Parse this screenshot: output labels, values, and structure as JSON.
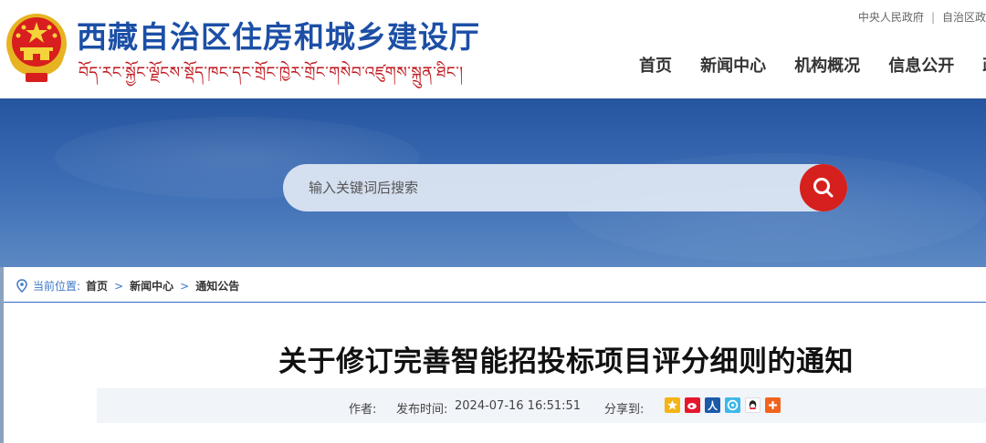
{
  "header": {
    "site_title": "西藏自治区住房和城乡建设厅",
    "site_subtitle": "བོད་རང་སྐྱོང་ལྗོངས་སྡོད་ཁང་དང་གྲོང་ཁྱེར་གྲོང་གསེབ་འཛུགས་སྐྲུན་ཐིང་།",
    "top_links": [
      "中央人民政府",
      "自治区政"
    ],
    "nav": [
      "首页",
      "新闻中心",
      "机构概况",
      "信息公开",
      "政"
    ]
  },
  "search": {
    "placeholder": "输入关键词后搜索"
  },
  "breadcrumb": {
    "label": "当前位置:",
    "items": [
      "首页",
      "新闻中心",
      "通知公告"
    ],
    "separator": ">"
  },
  "article": {
    "title": "关于修订完善智能招投标项目评分细则的通知",
    "author_label": "作者:",
    "published_label": "发布时间:",
    "published_value": "2024-07-16 16:51:51",
    "share_label": "分享到:",
    "share_targets": [
      "qzone-icon",
      "weibo-icon",
      "renren-icon",
      "tencent-icon",
      "qq-icon",
      "more-share-icon"
    ]
  },
  "colors": {
    "brand_blue": "#1c4fa6",
    "accent_red": "#d6201e",
    "banner_blue": "#3a6bb3",
    "link_blue": "#3c77c8"
  }
}
